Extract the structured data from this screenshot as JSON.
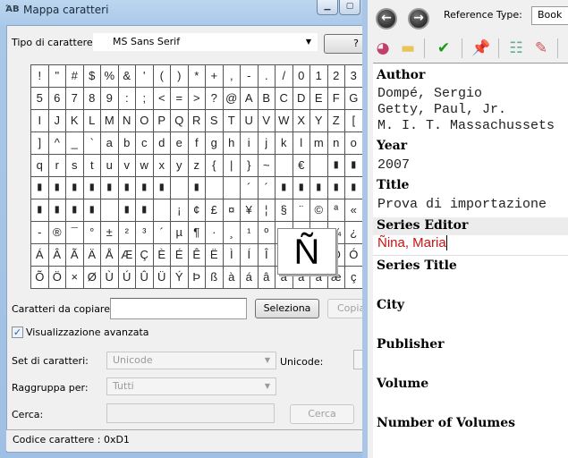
{
  "charmap": {
    "title": "Mappa caratteri",
    "app_icon": "charmap-icon",
    "font_label": "Tipo di carattere:",
    "font_value": "MS Sans Serif",
    "help_button": "?",
    "grid": [
      [
        "!",
        "\"",
        "#",
        "$",
        "%",
        "&",
        "'",
        "(",
        ")",
        "*",
        "+",
        ",",
        "-",
        ".",
        "/",
        "0",
        "1",
        "2",
        "3"
      ],
      [
        "5",
        "6",
        "7",
        "8",
        "9",
        ":",
        ";",
        "<",
        "=",
        ">",
        "?",
        "@",
        "A",
        "B",
        "C",
        "D",
        "E",
        "F",
        "G"
      ],
      [
        "I",
        "J",
        "K",
        "L",
        "M",
        "N",
        "O",
        "P",
        "Q",
        "R",
        "S",
        "T",
        "U",
        "V",
        "W",
        "X",
        "Y",
        "Z",
        "["
      ],
      [
        "]",
        "^",
        "_",
        "`",
        "a",
        "b",
        "c",
        "d",
        "e",
        "f",
        "g",
        "h",
        "i",
        "j",
        "k",
        "l",
        "m",
        "n",
        "o"
      ],
      [
        "q",
        "r",
        "s",
        "t",
        "u",
        "v",
        "w",
        "x",
        "y",
        "z",
        "{",
        "|",
        "}",
        "~",
        "",
        "€",
        "",
        "▮",
        "▮"
      ],
      [
        "▮",
        "▮",
        "▮",
        "▮",
        "▮",
        "▮",
        "▮",
        "▮",
        "",
        "▮",
        "",
        "",
        "´",
        "´",
        "▮",
        "▮",
        "▮",
        "▮",
        "▮"
      ],
      [
        "▮",
        "▮",
        "▮",
        "▮",
        "",
        "▮",
        "▮",
        "",
        "¡",
        "¢",
        "£",
        "¤",
        "¥",
        "¦",
        "§",
        "¨",
        "©",
        "ª",
        "«"
      ],
      [
        "-",
        "®",
        "¯",
        "°",
        "±",
        "²",
        "³",
        "´",
        "µ",
        "¶",
        "·",
        "¸",
        "¹",
        "º",
        "»",
        "¼",
        "½",
        "¾",
        "¿"
      ],
      [
        "Á",
        "Â",
        "Ã",
        "Ä",
        "Å",
        "Æ",
        "Ç",
        "È",
        "É",
        "Ê",
        "Ë",
        "Ì",
        "Í",
        "Î",
        "Ï",
        "Ð",
        "Ñ",
        "Ò",
        "Ó"
      ],
      [
        "Õ",
        "Ö",
        "×",
        "Ø",
        "Ù",
        "Ú",
        "Û",
        "Ü",
        "Ý",
        "Þ",
        "ß",
        "à",
        "á",
        "â",
        "ã",
        "ä",
        "å",
        "æ",
        "ç"
      ]
    ],
    "magnified_char": "Ñ",
    "copy_label": "Caratteri da copiare:",
    "copy_value": "",
    "select_button": "Seleziona",
    "copy_button": "Copia",
    "advanced_label": "Visualizzazione avanzata",
    "advanced_checked": true,
    "charset_label": "Set di caratteri:",
    "charset_value": "Unicode",
    "unicode_label": "Unicode:",
    "group_label": "Raggruppa per:",
    "group_value": "Tutti",
    "search_label": "Cerca:",
    "search_value": "",
    "search_button": "Cerca",
    "status": "Codice carattere : 0xD1"
  },
  "reference": {
    "type_label": "Reference Type:",
    "type_value": "Book",
    "toolbar_icons": [
      "globe-icon",
      "folder-icon",
      "checkmark-icon",
      "pushpin-icon",
      "checklist-icon",
      "edit-list-icon"
    ],
    "fields": [
      {
        "label": "Author",
        "values": [
          "Dompé, Sergio",
          "Getty, Paul, Jr.",
          "M. I. T. Massachussets"
        ]
      },
      {
        "label": "Year",
        "values": [
          "2007"
        ]
      },
      {
        "label": "Title",
        "values": [
          "Prova di importazione"
        ]
      },
      {
        "label": "Series Editor",
        "values": [
          "Ñina, Maria"
        ]
      },
      {
        "label": "Series Title",
        "values": []
      },
      {
        "label": "City",
        "values": []
      },
      {
        "label": "Publisher",
        "values": []
      },
      {
        "label": "Volume",
        "values": []
      },
      {
        "label": "Number of Volumes",
        "values": []
      }
    ],
    "active_text_color": "#cc1111"
  }
}
